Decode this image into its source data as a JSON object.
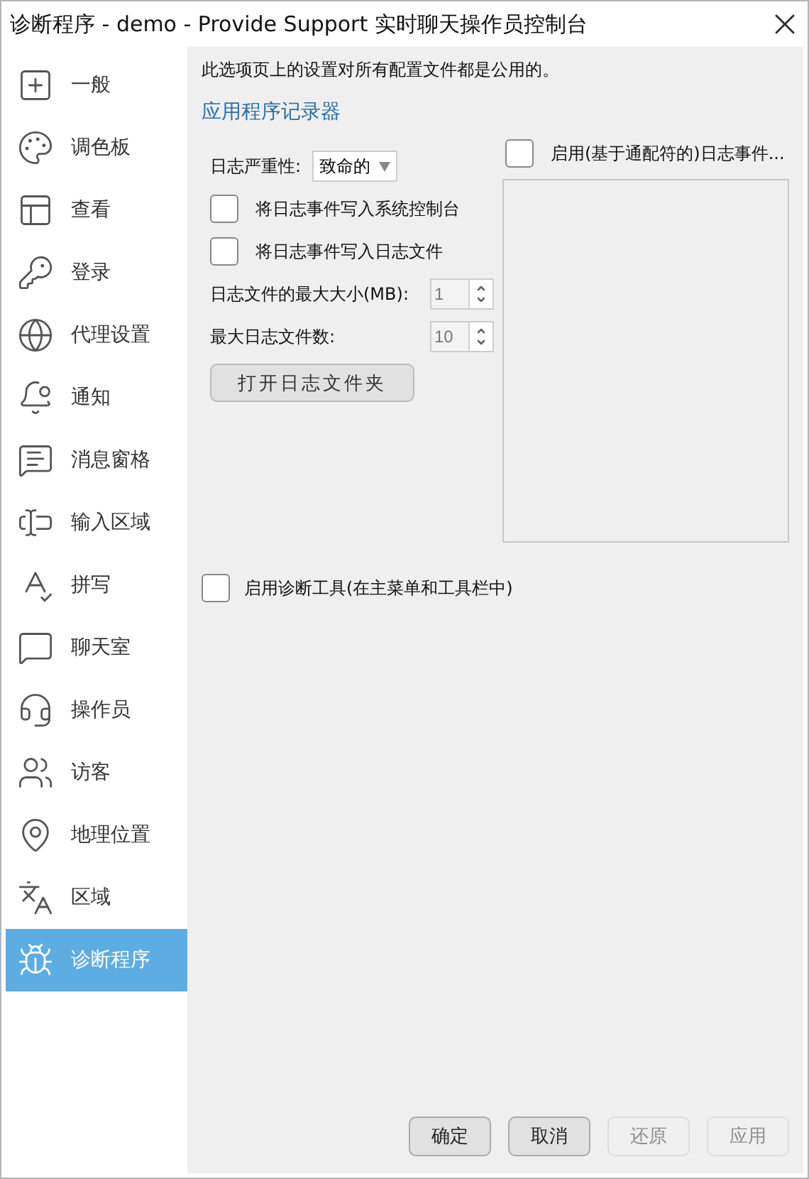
{
  "window": {
    "title": "诊断程序 - demo - Provide Support 实时聊天操作员控制台"
  },
  "sidebar": {
    "items": [
      {
        "label": "一般",
        "selected": false
      },
      {
        "label": "调色板",
        "selected": false
      },
      {
        "label": "查看",
        "selected": false
      },
      {
        "label": "登录",
        "selected": false
      },
      {
        "label": "代理设置",
        "selected": false
      },
      {
        "label": "通知",
        "selected": false
      },
      {
        "label": "消息窗格",
        "selected": false
      },
      {
        "label": "输入区域",
        "selected": false
      },
      {
        "label": "拼写",
        "selected": false
      },
      {
        "label": "聊天室",
        "selected": false
      },
      {
        "label": "操作员",
        "selected": false
      },
      {
        "label": "访客",
        "selected": false
      },
      {
        "label": "地理位置",
        "selected": false
      },
      {
        "label": "区域",
        "selected": false
      },
      {
        "label": "诊断程序",
        "selected": true
      }
    ]
  },
  "content": {
    "note": "此选项页上的设置对所有配置文件都是公用的。",
    "section_title": "应用程序记录器",
    "severity": {
      "label": "日志严重性:",
      "value": "致命的"
    },
    "options": [
      {
        "label": "将日志事件写入系统控制台",
        "checked": false
      },
      {
        "label": "将日志事件写入日志文件",
        "checked": false
      }
    ],
    "spinners": [
      {
        "label": "日志文件的最大大小(MB):",
        "value": "1",
        "disabled": true
      },
      {
        "label": "最大日志文件数:",
        "value": "10",
        "disabled": true
      }
    ],
    "open_folder_button": "打开日志文件夹",
    "filter": {
      "label": "启用(基于通配符的)日志事件...",
      "checked": false
    },
    "diagnostics_tools": {
      "label": "启用诊断工具(在主菜单和工具栏中)",
      "checked": false
    }
  },
  "buttons": [
    {
      "label": "确定",
      "disabled": false
    },
    {
      "label": "取消",
      "disabled": false
    },
    {
      "label": "还原",
      "disabled": true
    },
    {
      "label": "应用",
      "disabled": true
    }
  ]
}
